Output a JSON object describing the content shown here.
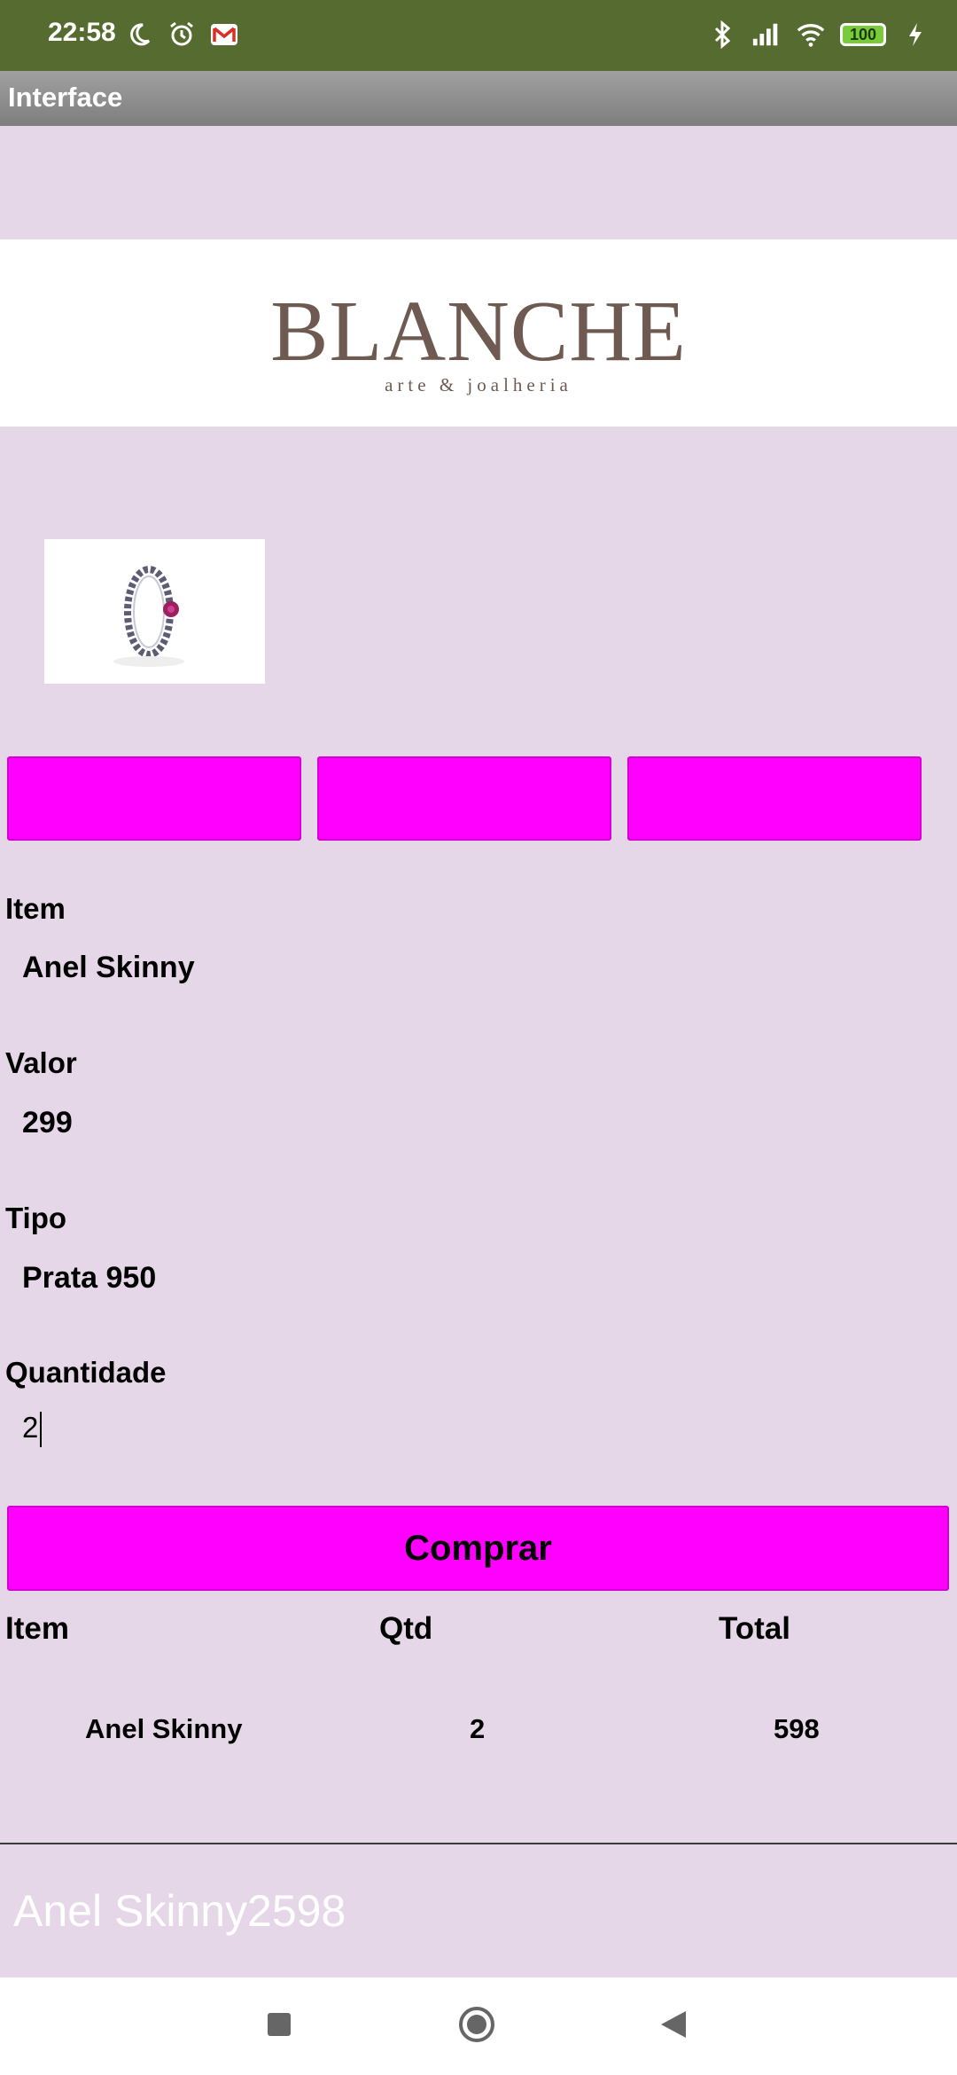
{
  "status_bar": {
    "time": "22:58",
    "battery": "100",
    "icons_left": [
      "moon-icon",
      "alarm-icon",
      "gmail-icon"
    ],
    "icons_right": [
      "bluetooth-icon",
      "signal-icon",
      "wifi-icon",
      "battery-icon",
      "charging-icon"
    ]
  },
  "title_bar": {
    "title": "Interface"
  },
  "logo": {
    "main": "BLANCHE",
    "sub": "arte & joalheria"
  },
  "product": {
    "image": "ring-image"
  },
  "form": {
    "item_label": "Item",
    "item_value": "Anel Skinny",
    "valor_label": "Valor",
    "valor_value": "299",
    "tipo_label": "Tipo",
    "tipo_value": "Prata 950",
    "quantidade_label": "Quantidade",
    "quantidade_value": "2"
  },
  "buy_button": {
    "label": "Comprar"
  },
  "table": {
    "headers": [
      "Item",
      "Qtd",
      "Total"
    ],
    "rows": [
      {
        "item": "Anel Skinny",
        "qtd": "2",
        "total": "598"
      }
    ]
  },
  "summary": {
    "text": "Anel Skinny2598"
  },
  "colors": {
    "status_bar": "#556b2f",
    "background": "#e6d7e8",
    "accent": "#ff00ff",
    "logo_text": "#6e5a50"
  }
}
